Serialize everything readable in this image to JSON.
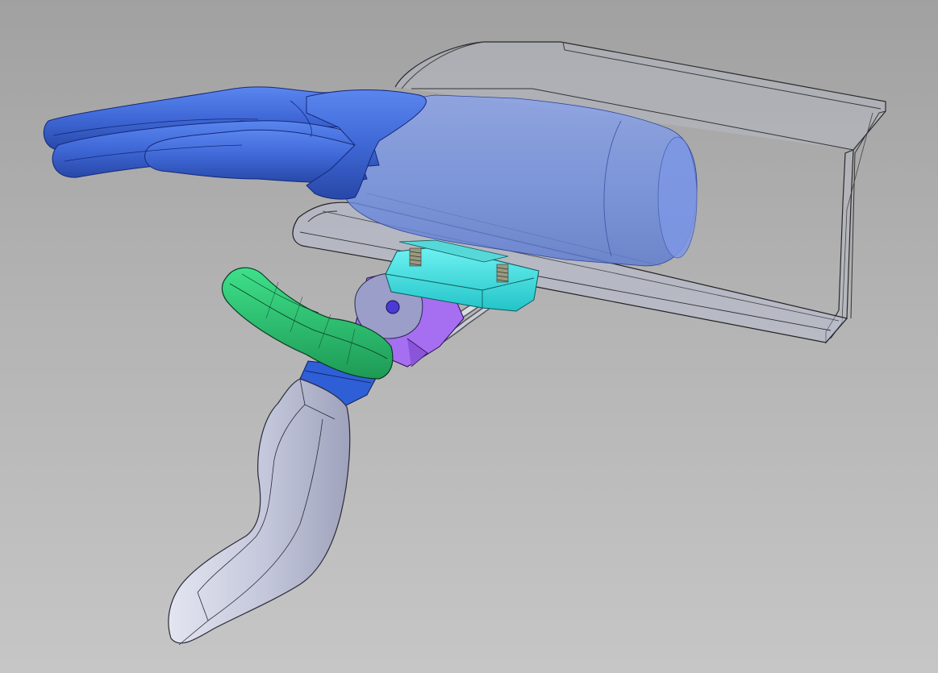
{
  "viewport": {
    "background_top": "#a1a1a1",
    "background_bottom": "#c6c6c6"
  },
  "parts": {
    "hand": {
      "color": "#3f68d6"
    },
    "forearm": {
      "color": "#6f8ee0"
    },
    "splint_shell": {
      "color": "#b9bfd3"
    },
    "mount_plate": {
      "color": "#3ee4e4"
    },
    "bracket": {
      "color": "#a66ef0"
    },
    "thumb_lever": {
      "color": "#2fbf6e"
    },
    "coupler": {
      "color": "#2f5fd6"
    },
    "handle": {
      "color": "#c3c6da"
    },
    "springs": {
      "color": "#7a7a6a"
    },
    "cable": {
      "color": "#d8dce6"
    }
  }
}
